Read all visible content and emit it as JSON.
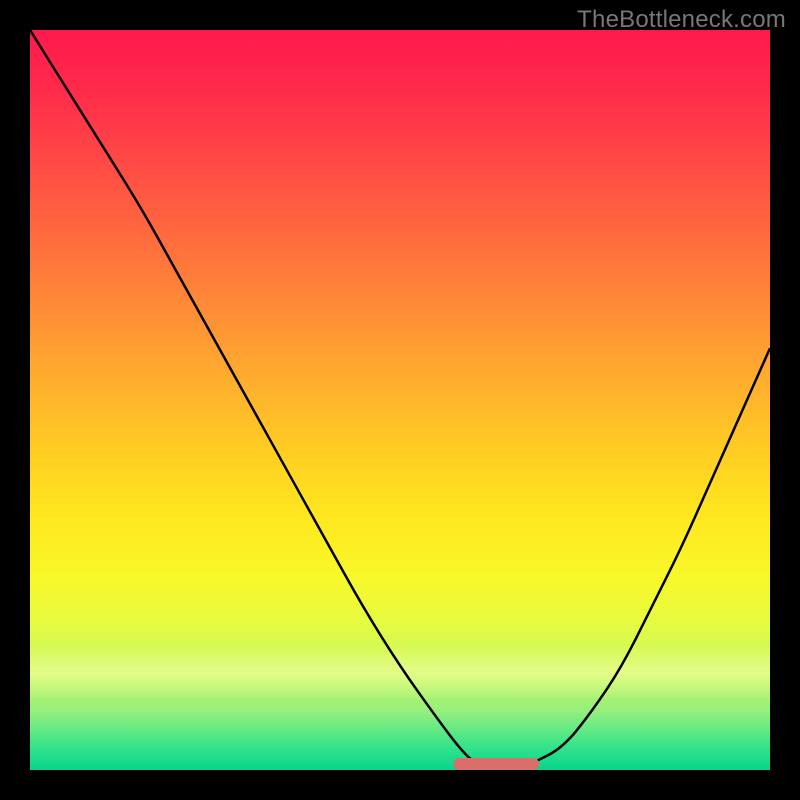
{
  "watermark": "TheBottleneck.com",
  "colors": {
    "gradient_top": "#ff1a4e",
    "gradient_mid": "#ffd022",
    "gradient_bottom": "#06d58c",
    "curve": "#000000",
    "trough_highlight": "#d96f6a",
    "border": "#000000"
  },
  "chart_data": {
    "type": "line",
    "title": "",
    "xlabel": "",
    "ylabel": "",
    "xlim": [
      0,
      100
    ],
    "ylim": [
      0,
      100
    ],
    "x": [
      0,
      5,
      10,
      15,
      20,
      25,
      30,
      35,
      40,
      45,
      50,
      55,
      58,
      60,
      63,
      66,
      68,
      72,
      76,
      80,
      84,
      88,
      92,
      96,
      100
    ],
    "values": [
      100,
      92,
      84,
      76,
      67,
      58,
      49,
      40,
      31,
      22,
      14,
      7,
      3,
      1,
      0,
      0,
      1,
      3,
      8,
      14,
      22,
      30,
      39,
      48,
      57
    ],
    "trough_x_range": [
      58,
      68
    ],
    "trough_value": 0,
    "annotations": []
  }
}
